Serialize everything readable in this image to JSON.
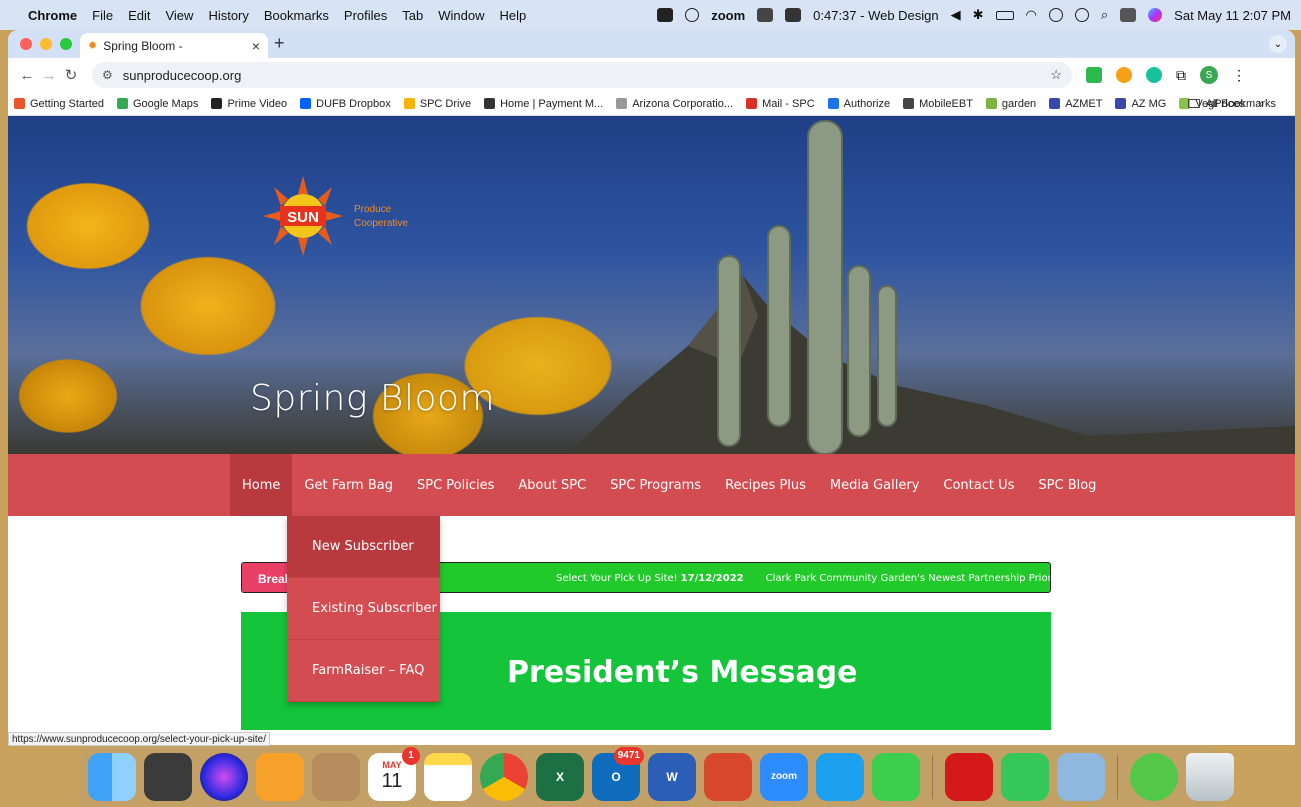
{
  "menubar": {
    "app": "Chrome",
    "items": [
      "File",
      "Edit",
      "View",
      "History",
      "Bookmarks",
      "Profiles",
      "Tab",
      "Window",
      "Help"
    ],
    "zoom": "zoom",
    "timer": "0:47:37 - Web Design",
    "datetime": "Sat May 11  2:07 PM"
  },
  "browser": {
    "tab_title": "Spring Bloom -",
    "url": "sunproducecoop.org",
    "profile_initial": "S"
  },
  "bookmarks": [
    {
      "label": "Getting Started",
      "color": "#e8562e"
    },
    {
      "label": "Google Maps",
      "color": "#34a853"
    },
    {
      "label": "Prime Video",
      "color": "#222222"
    },
    {
      "label": "DUFB Dropbox",
      "color": "#0061fe"
    },
    {
      "label": "SPC Drive",
      "color": "#f4b400"
    },
    {
      "label": "Home | Payment M...",
      "color": "#333333"
    },
    {
      "label": "Arizona Corporatio...",
      "color": "#999999"
    },
    {
      "label": "Mail - SPC",
      "color": "#d93025"
    },
    {
      "label": "Authorize",
      "color": "#1a73e8"
    },
    {
      "label": "MobileEBT",
      "color": "#444444"
    },
    {
      "label": "garden",
      "color": "#7cb342"
    },
    {
      "label": "AZMET",
      "color": "#3949ab"
    },
    {
      "label": "AZ MG",
      "color": "#3949ab"
    },
    {
      "label": "VegPrices",
      "color": "#8bc34a"
    }
  ],
  "all_bookmarks": "All Bookmarks",
  "hero": {
    "title": "Spring Bloom",
    "logo_word": "SUN",
    "logo_line1": "Produce",
    "logo_line2": "Cooperative"
  },
  "nav": [
    "Home",
    "Get Farm Bag",
    "SPC Policies",
    "About SPC",
    "SPC Programs",
    "Recipes Plus",
    "Media Gallery",
    "Contact Us",
    "SPC Blog"
  ],
  "dropdown": [
    "New Subscriber",
    "Existing Subscriber",
    "FarmRaiser – FAQ"
  ],
  "ticker": {
    "label": "Break",
    "item1": "Select Your Pick Up Site!",
    "item1_date": "17/12/2022",
    "item2": "Clark Park Community Garden's Newest Partnership Prioritizes Sustain"
  },
  "president": {
    "heading": "President’s Message"
  },
  "status_url": "https://www.sunproducecoop.org/select-your-pick-up-site/",
  "dock": {
    "calendar_month": "MAY",
    "calendar_day": "11",
    "calendar_badge": "1",
    "outlook_badge": "9471",
    "zoom_label": "zoom"
  }
}
